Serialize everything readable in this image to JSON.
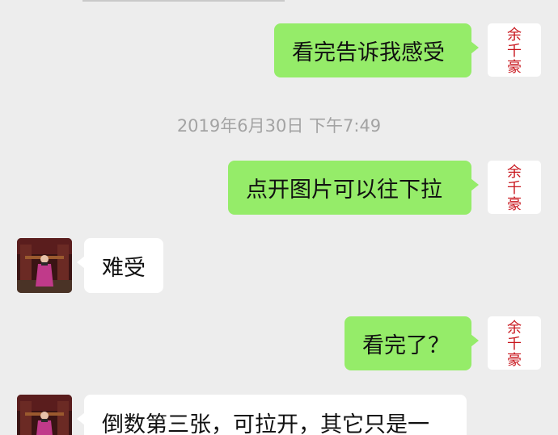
{
  "messages": {
    "m1": "看完告诉我感受",
    "time": "2019年6月30日 下午7:49",
    "m2": "点开图片可以往下拉",
    "m3": "难受",
    "m4": "看完了？",
    "m5": "倒数第三张，可拉开，其它只是一"
  },
  "avatars": {
    "me_seal": [
      "余",
      "千",
      "豪"
    ]
  },
  "colors": {
    "background": "#ededed",
    "sent_bubble": "#95ec69",
    "received_bubble": "#ffffff",
    "seal_red": "#c8161d",
    "timestamp": "#a3a3a3"
  }
}
